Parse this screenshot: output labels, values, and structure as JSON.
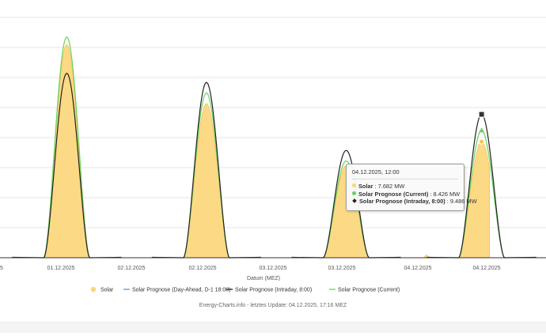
{
  "chart_data": {
    "type": "area",
    "title": "",
    "xlabel": "Datum (MEZ)",
    "ylabel": "",
    "x_tick_labels": [
      "01.12.2025",
      "02.12.2025",
      "02.12.2025",
      "03.12.2025",
      "03.12.2025",
      "04.12.2025",
      "04.12.2025"
    ],
    "ylim": [
      0,
      15.9
    ],
    "grid": "horizontal",
    "legend_position": "bottom",
    "series": [
      {
        "name": "Solar",
        "color": "#fcd577",
        "style": "area",
        "peaks": [
          {
            "day": 1,
            "hour": 12.0,
            "value": 14.1
          },
          {
            "day": 2,
            "hour": 12.25,
            "value": 10.2
          },
          {
            "day": 3,
            "hour": 12.5,
            "value": 6.1
          },
          {
            "day": 4,
            "hour": 12.0,
            "value": 7.682
          }
        ]
      },
      {
        "name": "Solar Prognose (Day-Ahead, D-1 18:00)",
        "color": "#5b9bd5",
        "style": "line",
        "peaks": []
      },
      {
        "name": "Solar Prognose (Intraday, 8:00)",
        "color": "#222222",
        "style": "line",
        "peaks": [
          {
            "day": 1,
            "hour": 12.0,
            "value": 12.2
          },
          {
            "day": 2,
            "hour": 12.25,
            "value": 11.6
          },
          {
            "day": 3,
            "hour": 12.5,
            "value": 7.1
          },
          {
            "day": 4,
            "hour": 12.0,
            "value": 9.486
          }
        ]
      },
      {
        "name": "Solar Prognose (Current)",
        "color": "#66d35c",
        "style": "line",
        "peaks": [
          {
            "day": 1,
            "hour": 12.0,
            "value": 14.6
          },
          {
            "day": 2,
            "hour": 12.25,
            "value": 10.9
          },
          {
            "day": 3,
            "hour": 12.5,
            "value": 6.4
          },
          {
            "day": 4,
            "hour": 12.0,
            "value": 8.426
          }
        ]
      }
    ],
    "tooltip": {
      "timestamp": "04.12.2025, 12:00",
      "rows": [
        {
          "name": "Solar",
          "value": "7.682 MW",
          "color": "#fcd577",
          "marker": "dot"
        },
        {
          "name": "Solar Prognose (Current)",
          "value": "8.426 MW",
          "color": "#66d35c",
          "marker": "dot"
        },
        {
          "name": "Solar Prognose (Intraday, 8:00)",
          "value": "9.486 MW",
          "color": "#222222",
          "marker": "diamond"
        }
      ]
    }
  },
  "footer": {
    "text": "Energy-Charts.info - letztes Update: 04.12.2025, 17:16 MEZ"
  }
}
